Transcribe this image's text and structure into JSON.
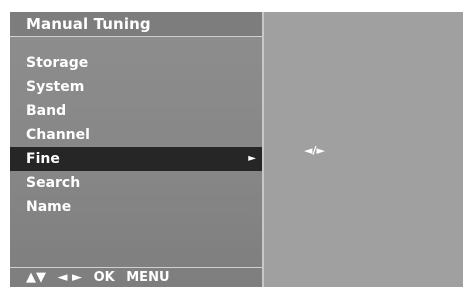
{
  "title": "Manual Tuning",
  "menu": {
    "items": [
      {
        "label": "Storage"
      },
      {
        "label": "System"
      },
      {
        "label": "Band"
      },
      {
        "label": "Channel"
      },
      {
        "label": "Fine",
        "arrow": "►"
      },
      {
        "label": "Search"
      },
      {
        "label": "Name"
      }
    ],
    "selected": "Fine"
  },
  "footer": {
    "updown": "▲▼",
    "leftright": "◄ ►",
    "ok": "OK",
    "menu": "MENU"
  },
  "right_panel": {
    "hint": "◄/►"
  },
  "colors": {
    "panel": "#868686",
    "selected_bg": "#262626",
    "right_panel": "#a0a0a0",
    "text": "#ffffff"
  }
}
